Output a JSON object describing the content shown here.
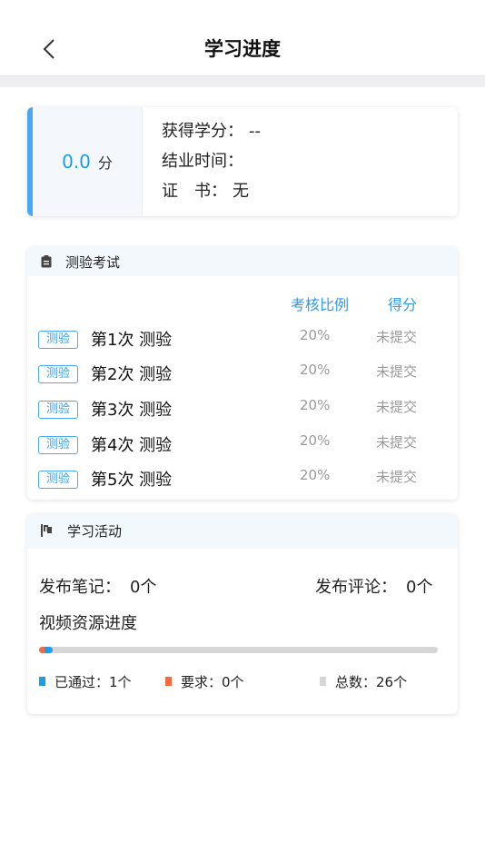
{
  "header": {
    "title": "学习进度"
  },
  "score": {
    "value": "0.0",
    "unit": "分",
    "credit_label": "获得学分：",
    "credit_value": "--",
    "completion_label": "结业时间：",
    "completion_value": "",
    "certificate_label": "证　书：",
    "certificate_value": "无"
  },
  "quiz": {
    "section_title": "测验考试",
    "col_ratio": "考核比例",
    "col_score": "得分",
    "rows": [
      {
        "tag": "测验",
        "name": "第1次 测验",
        "ratio": "20%",
        "status": "未提交"
      },
      {
        "tag": "测验",
        "name": "第2次 测验",
        "ratio": "20%",
        "status": "未提交"
      },
      {
        "tag": "测验",
        "name": "第3次 测验",
        "ratio": "20%",
        "status": "未提交"
      },
      {
        "tag": "测验",
        "name": "第4次 测验",
        "ratio": "20%",
        "status": "未提交"
      },
      {
        "tag": "测验",
        "name": "第5次 测验",
        "ratio": "20%",
        "status": "未提交"
      }
    ]
  },
  "activity": {
    "section_title": "学习活动",
    "notes_label": "发布笔记：",
    "notes_value": "0个",
    "comments_label": "发布评论：",
    "comments_value": "0个",
    "video_title": "视频资源进度",
    "progress": {
      "passed": 1,
      "required": 0,
      "total": 26
    },
    "legend": {
      "passed": "已通过：1个",
      "required": "要求：0个",
      "total": "总数：26个"
    }
  },
  "colors": {
    "accent": "#1a9ee8",
    "required": "#f26a3d",
    "track": "#d6d6d6"
  }
}
